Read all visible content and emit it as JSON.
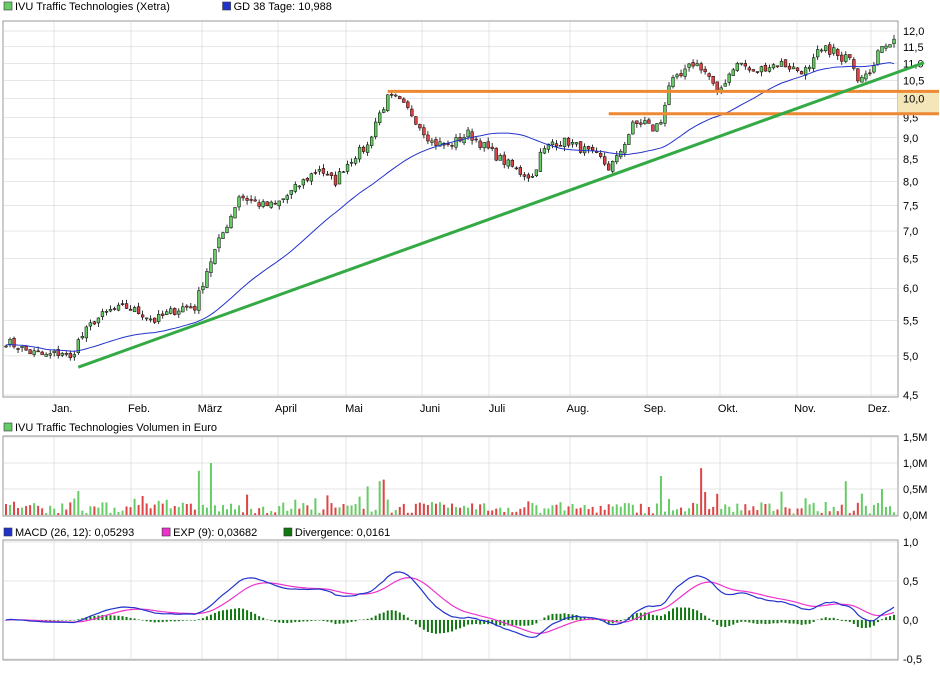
{
  "colors": {
    "up": "#66cc66",
    "down": "#dd4444",
    "price_line": "#000000",
    "ma": "#2233cc",
    "trend": "#33aa44",
    "resistance": "#ee8833",
    "zone_fill": "#f3e6b8",
    "volume_neutral": "#cccccc",
    "macd": "#2233cc",
    "signal": "#ee33cc",
    "divergence": "#117711",
    "grid": "#cccccc"
  },
  "chart_data": [
    {
      "type": "line",
      "legend": [
        {
          "label": "IVU Traffic Technologies (Xetra)",
          "swatch": "up"
        },
        {
          "label": "GD 38 Tage: 10,988",
          "swatch": "ma"
        }
      ],
      "x_ticks": [
        "Jan.",
        "Feb.",
        "März",
        "April",
        "Mai",
        "Juni",
        "Juli",
        "Aug.",
        "Sep.",
        "Okt.",
        "Nov.",
        "Dez."
      ],
      "y_ticks": [
        "12,0",
        "11,5",
        "11,0",
        "10,5",
        "10,0",
        "9,5",
        "9,0",
        "8,5",
        "8,0",
        "7,5",
        "7,0",
        "6,5",
        "6,0",
        "5,5",
        "5,0",
        "4,5"
      ],
      "ylim": [
        4.5,
        12.0
      ],
      "y_scale": "log",
      "price_waypoints": [
        [
          0,
          5.2
        ],
        [
          2,
          5.15
        ],
        [
          6,
          5.05
        ],
        [
          10,
          5.0
        ],
        [
          14,
          5.05
        ],
        [
          16,
          4.95
        ],
        [
          18,
          5.2
        ],
        [
          22,
          5.5
        ],
        [
          26,
          5.65
        ],
        [
          30,
          5.7
        ],
        [
          34,
          5.6
        ],
        [
          37,
          5.5
        ],
        [
          40,
          5.6
        ],
        [
          44,
          5.7
        ],
        [
          47,
          5.7
        ],
        [
          50,
          6.3
        ],
        [
          53,
          6.8
        ],
        [
          56,
          7.3
        ],
        [
          58,
          7.7
        ],
        [
          61,
          7.6
        ],
        [
          64,
          7.5
        ],
        [
          67,
          7.5
        ],
        [
          70,
          7.7
        ],
        [
          74,
          8.0
        ],
        [
          78,
          8.3
        ],
        [
          80,
          8.1
        ],
        [
          82,
          8.0
        ],
        [
          84,
          8.3
        ],
        [
          87,
          8.6
        ],
        [
          90,
          8.8
        ],
        [
          92,
          9.4
        ],
        [
          95,
          10.0
        ],
        [
          97,
          10.0
        ],
        [
          99,
          9.8
        ],
        [
          101,
          9.6
        ],
        [
          103,
          9.3
        ],
        [
          106,
          8.9
        ],
        [
          110,
          8.8
        ],
        [
          115,
          9.1
        ],
        [
          119,
          8.8
        ],
        [
          123,
          8.5
        ],
        [
          128,
          8.2
        ],
        [
          131,
          8.1
        ],
        [
          133,
          8.6
        ],
        [
          136,
          8.9
        ],
        [
          140,
          8.9
        ],
        [
          144,
          8.7
        ],
        [
          148,
          8.5
        ],
        [
          150,
          8.3
        ],
        [
          152,
          8.5
        ],
        [
          154,
          8.9
        ],
        [
          156,
          9.3
        ],
        [
          159,
          9.4
        ],
        [
          161,
          9.2
        ],
        [
          163,
          9.4
        ],
        [
          165,
          10.4
        ],
        [
          168,
          10.6
        ],
        [
          171,
          11.0
        ],
        [
          173,
          10.9
        ],
        [
          175,
          10.6
        ],
        [
          177,
          10.1
        ],
        [
          179,
          10.5
        ],
        [
          181,
          10.9
        ],
        [
          183,
          11.0
        ],
        [
          186,
          10.7
        ],
        [
          189,
          10.9
        ],
        [
          193,
          11.0
        ],
        [
          197,
          10.8
        ],
        [
          200,
          10.8
        ],
        [
          202,
          11.3
        ],
        [
          204,
          11.4
        ],
        [
          206,
          11.4
        ],
        [
          208,
          11.0
        ],
        [
          210,
          11.3
        ],
        [
          212,
          10.6
        ],
        [
          214,
          10.8
        ],
        [
          216,
          10.9
        ],
        [
          218,
          11.6
        ]
      ],
      "ma_values": {
        "first": 5.15,
        "last": 10.988
      },
      "resistance_lines": [
        {
          "value": 10.2,
          "from_index": 95
        },
        {
          "value": 9.6,
          "from_index": 150
        }
      ],
      "zone_label": "10,0",
      "trendline": {
        "start": [
          18,
          4.85
        ],
        "end": [
          221,
          10.9
        ]
      }
    },
    {
      "type": "bar",
      "legend": [
        {
          "label": "IVU Traffic Technologies Volumen in Euro",
          "swatch": "up"
        }
      ],
      "y_ticks": [
        "1,5M",
        "1,0M",
        "0,5M",
        "0,0M"
      ],
      "ylim": [
        0,
        1.5
      ],
      "unit": "M EUR",
      "notable_peaks": [
        {
          "index": 48,
          "value": 0.85,
          "dir": "up"
        },
        {
          "index": 51,
          "value": 1.0,
          "dir": "up"
        },
        {
          "index": 90,
          "value": 0.55,
          "dir": "up"
        },
        {
          "index": 93,
          "value": 0.65,
          "dir": "up"
        },
        {
          "index": 94,
          "value": 0.68,
          "dir": "down"
        },
        {
          "index": 163,
          "value": 0.75,
          "dir": "up"
        },
        {
          "index": 173,
          "value": 0.9,
          "dir": "down"
        },
        {
          "index": 209,
          "value": 0.65,
          "dir": "up"
        },
        {
          "index": 218,
          "value": 0.5,
          "dir": "up"
        }
      ]
    },
    {
      "type": "line",
      "legend": [
        {
          "label": "MACD (26, 12): 0,05293",
          "swatch": "macd"
        },
        {
          "label": "EXP (9): 0,03682",
          "swatch": "signal"
        },
        {
          "label": "Divergence: 0,0161",
          "swatch": "divergence"
        }
      ],
      "y_ticks": [
        "1,0",
        "0,5",
        "0,0",
        "-0,5"
      ],
      "ylim": [
        -0.5,
        1.0
      ]
    }
  ]
}
